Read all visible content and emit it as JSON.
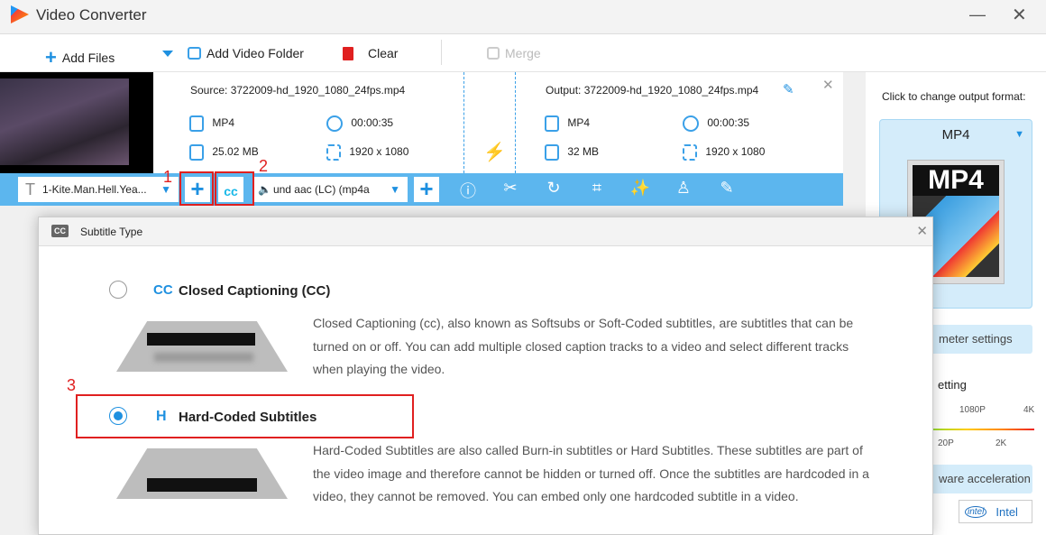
{
  "app": {
    "title": "Video Converter"
  },
  "toolbar": {
    "add_files": "Add Files",
    "add_folder": "Add Video Folder",
    "clear": "Clear",
    "merge": "Merge"
  },
  "file": {
    "source": "Source: 3722009-hd_1920_1080_24fps.mp4",
    "output": "Output: 3722009-hd_1920_1080_24fps.mp4",
    "src_format": "MP4",
    "src_duration": "00:00:35",
    "src_size": "25.02 MB",
    "src_res": "1920 x 1080",
    "out_format": "MP4",
    "out_duration": "00:00:35",
    "out_size": "32 MB",
    "out_res": "1920 x 1080"
  },
  "bar": {
    "subtitle": "1-Kite.Man.Hell.Yea...",
    "audio": "und aac (LC) (mp4a"
  },
  "annotations": {
    "n1": "1",
    "n2": "2",
    "n3": "3"
  },
  "right": {
    "prompt": "Click to change output format:",
    "format": "MP4",
    "format_img": "MP4",
    "param": "meter settings",
    "quality": "etting",
    "ticks_top": [
      "1080P",
      "4K"
    ],
    "ticks_bottom": [
      "20P",
      "2K"
    ],
    "hw": "ware acceleration",
    "intel": "Intel",
    "intel_logo": "intel"
  },
  "dialog": {
    "title": "Subtitle Type",
    "cc_icon": "CC",
    "opt1": {
      "icon": "CC",
      "label": "Closed Captioning (CC)",
      "desc": "Closed Captioning (cc), also known as Softsubs or Soft-Coded subtitles, are subtitles that can be turned on or off. You can add multiple closed caption tracks to a video and select different tracks when playing the video.",
      "selected": false
    },
    "opt2": {
      "icon": "H",
      "label": "Hard-Coded Subtitles",
      "desc": "Hard-Coded Subtitles are also called Burn-in subtitles or Hard Subtitles. These subtitles are part of the video image and therefore cannot be hidden or turned off. Once the subtitles are hardcoded in a video, they cannot be removed. You can embed only one hardcoded subtitle in a video.",
      "selected": true
    }
  },
  "colors": {
    "accent": "#1e90e0",
    "bar": "#5cb6ee",
    "annotation": "#e02020"
  }
}
